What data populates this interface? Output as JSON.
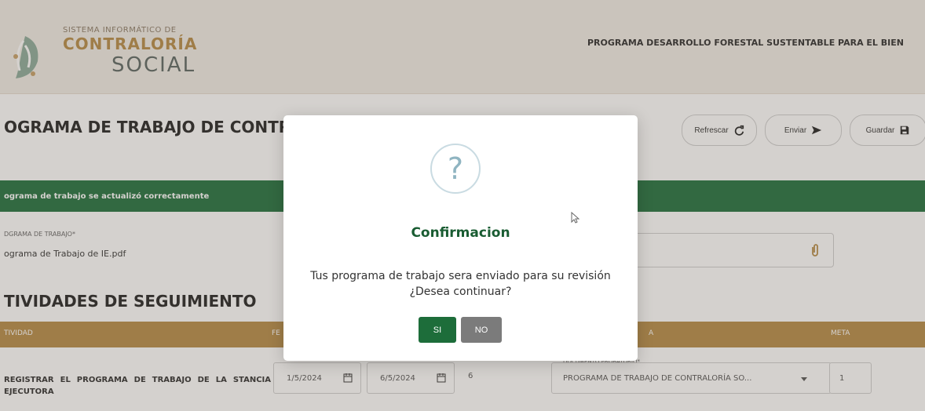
{
  "header": {
    "logo": {
      "line1": "SISTEMA INFORMÁTICO DE",
      "line2": "CONTRALORÍA",
      "line3": "SOCIAL"
    },
    "program_title": "PROGRAMA DESARROLLO FORESTAL SUSTENTABLE PARA EL BIEN"
  },
  "page": {
    "title": "OGRAMA DE TRABAJO DE CONTRA",
    "buttons": {
      "refresh": "Refrescar",
      "send": "Enviar",
      "save": "Guardar"
    },
    "success_message": "ograma de trabajo se actualizó correctamente",
    "work_program_label": "DGRAMA DE TRABAJO*",
    "work_program_value": "ograma de Trabajo de IE.pdf",
    "activities_title": "TIVIDADES DE SEGUIMIENTO",
    "table": {
      "headers": {
        "activity": "TIVIDAD",
        "date": "FE",
        "document": "A",
        "meta": "META"
      },
      "row": {
        "activity": "REGISTRAR EL PROGRAMA DE TRABAJO DE LA STANCIA EJECUTORA",
        "start_date": "1/5/2024",
        "end_date": "6/5/2024",
        "days": "6",
        "document_caption": "DOCUMENTO PROBATORIO*",
        "document_value": "PROGRAMA DE TRABAJO DE CONTRALORÍA SO...",
        "meta": "1"
      }
    }
  },
  "modal": {
    "icon_symbol": "?",
    "title": "Confirmacion",
    "message": "Tus programa de trabajo sera enviado para su revisión ¿Desea continuar?",
    "yes_label": "SI",
    "no_label": "NO"
  },
  "icons": [
    "logo-leaf-icon",
    "refresh-icon",
    "send-icon",
    "save-icon",
    "paperclip-icon",
    "calendar-icon",
    "chevron-down-icon",
    "question-icon",
    "mouse-cursor-icon"
  ],
  "colors": {
    "brand_gold": "#b68b46",
    "brand_green": "#1f6f3c",
    "modal_yes": "#1d6d3a",
    "modal_no": "#7b7b7b",
    "question_ring": "#c9dbe2"
  }
}
